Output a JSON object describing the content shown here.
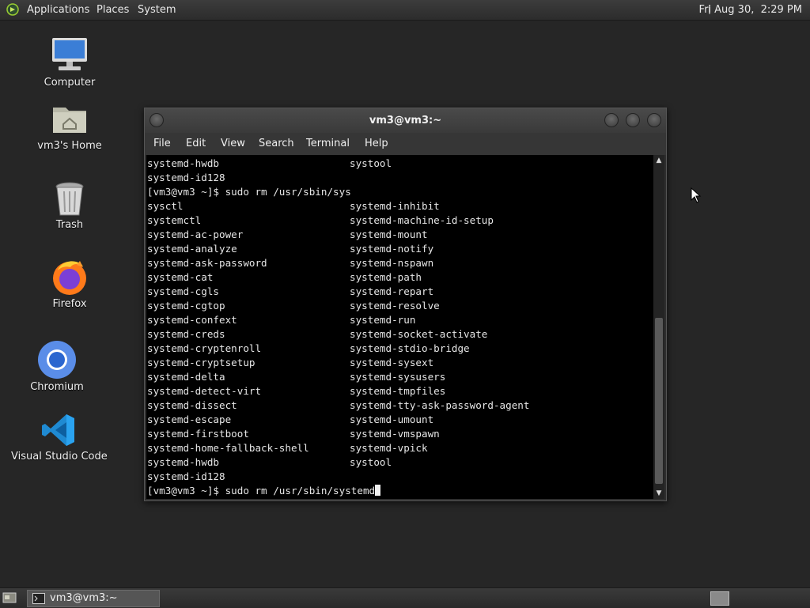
{
  "top_panel": {
    "menus": [
      "Applications",
      "Places",
      "System"
    ],
    "clock": "Fri Aug 30,  2:29 PM"
  },
  "desktop_icons": [
    {
      "label": "Computer",
      "icon": "computer-icon"
    },
    {
      "label": "vm3's Home",
      "icon": "home-folder-icon"
    },
    {
      "label": "Trash",
      "icon": "trash-icon"
    },
    {
      "label": "Firefox",
      "icon": "firefox-icon"
    },
    {
      "label": "Chromium",
      "icon": "chromium-icon"
    },
    {
      "label": "Visual Studio Code",
      "icon": "vscode-icon"
    }
  ],
  "terminal": {
    "title": "vm3@vm3:~",
    "menu": [
      "File",
      "Edit",
      "View",
      "Search",
      "Terminal",
      "Help"
    ],
    "lines": [
      [
        "systemd-hwdb",
        "systool"
      ],
      [
        "systemd-id128",
        ""
      ],
      [
        "[vm3@vm3 ~]$ sudo rm /usr/sbin/sys",
        ""
      ],
      [
        "sysctl",
        "systemd-inhibit"
      ],
      [
        "systemctl",
        "systemd-machine-id-setup"
      ],
      [
        "systemd-ac-power",
        "systemd-mount"
      ],
      [
        "systemd-analyze",
        "systemd-notify"
      ],
      [
        "systemd-ask-password",
        "systemd-nspawn"
      ],
      [
        "systemd-cat",
        "systemd-path"
      ],
      [
        "systemd-cgls",
        "systemd-repart"
      ],
      [
        "systemd-cgtop",
        "systemd-resolve"
      ],
      [
        "systemd-confext",
        "systemd-run"
      ],
      [
        "systemd-creds",
        "systemd-socket-activate"
      ],
      [
        "systemd-cryptenroll",
        "systemd-stdio-bridge"
      ],
      [
        "systemd-cryptsetup",
        "systemd-sysext"
      ],
      [
        "systemd-delta",
        "systemd-sysusers"
      ],
      [
        "systemd-detect-virt",
        "systemd-tmpfiles"
      ],
      [
        "systemd-dissect",
        "systemd-tty-ask-password-agent"
      ],
      [
        "systemd-escape",
        "systemd-umount"
      ],
      [
        "systemd-firstboot",
        "systemd-vmspawn"
      ],
      [
        "systemd-home-fallback-shell",
        "systemd-vpick"
      ],
      [
        "systemd-hwdb",
        "systool"
      ],
      [
        "systemd-id128",
        ""
      ]
    ],
    "prompt_line": "[vm3@vm3 ~]$ sudo rm /usr/sbin/systemd"
  },
  "bottom_panel": {
    "task_label": "vm3@vm3:~"
  }
}
